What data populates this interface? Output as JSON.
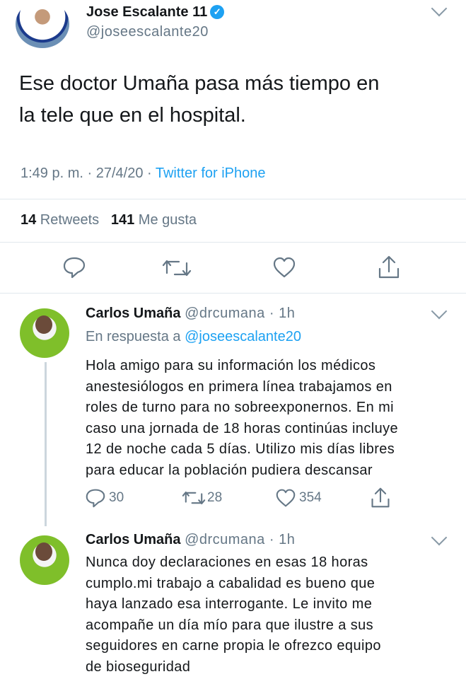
{
  "main_tweet": {
    "display_name": "Jose Escalante 11",
    "handle": "@joseescalante20",
    "text_line1": "Ese doctor Umaña pasa más tiempo en",
    "text_line2": "la tele que en el hospital.",
    "time": "1:49 p. m. · 27/4/20 · ",
    "source": "Twitter for iPhone",
    "retweets_count": "14",
    "retweets_label": " Retweets",
    "likes_count": "141",
    "likes_label": " Me gusta",
    "verified_glyph": "✓"
  },
  "replies": [
    {
      "display_name": "Carlos Umaña",
      "handle_time": "@drcumana · 1h",
      "in_reply_prefix": "En respuesta a ",
      "in_reply_handle": "@joseescalante20",
      "lines": [
        "Hola  amigo para su información los médicos",
        "anestesiólogos en primera línea trabajamos en",
        "roles de turno para no sobreexponernos. En mi",
        "caso una jornada de 18 horas continúas incluye",
        "12 de noche cada 5 días. Utilizo mis días libres",
        "para educar la población pudiera descansar"
      ],
      "reply_count": "30",
      "retweet_count": "28",
      "like_count": "354"
    },
    {
      "display_name": "Carlos Umaña",
      "handle_time": "@drcumana · 1h",
      "lines": [
        "Nunca doy declaraciones en esas 18 horas",
        "cumplo.mi trabajo a cabalidad es bueno que",
        "haya lanzado esa interrogante. Le invito me",
        "acompañe un día mío para que ilustre a sus",
        "seguidores en carne propia le ofrezco equipo",
        "de bioseguridad"
      ]
    }
  ],
  "icons": [
    "reply-icon",
    "retweet-icon",
    "like-icon",
    "share-icon",
    "verified-badge-icon",
    "chevron-down-icon"
  ],
  "colors": {
    "link": "#1da1f2",
    "secondary": "#657786",
    "divider": "#e1e8ed"
  }
}
